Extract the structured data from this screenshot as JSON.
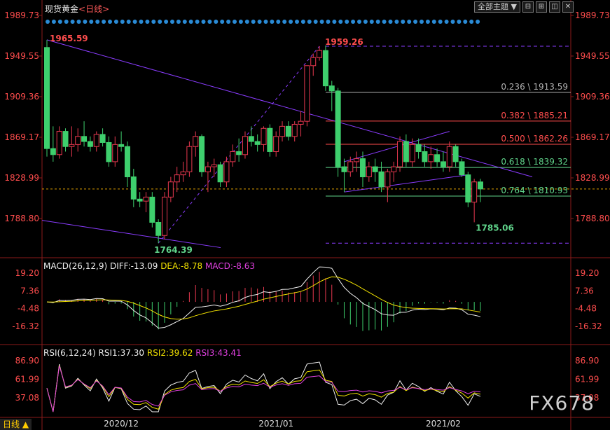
{
  "header": {
    "title": "现货黄金",
    "period": "<日线>",
    "theme_select": "全部主题",
    "icons": [
      "collapse-icon",
      "expand-icon",
      "restore-icon",
      "close-icon"
    ]
  },
  "tab_label": "日线",
  "watermark": "FX678",
  "colors": {
    "up": "#e8384f",
    "down": "#3ecf6d",
    "fib_trend": "#8a3cff",
    "accent_red": "#ff4d4d",
    "accent_green": "#5fd38a"
  },
  "main_axis": {
    "ticks": [
      "1989.73",
      "1949.55",
      "1909.36",
      "1869.17",
      "1828.99",
      "1788.80"
    ],
    "tick_values": [
      1989.73,
      1949.55,
      1909.36,
      1869.17,
      1828.99,
      1788.8
    ]
  },
  "macd": {
    "legend_prefix": "MACD(26,12,9)",
    "diff": "DIFF:-13.09",
    "dea": "DEA:-8.78",
    "macd": "MACD:-8.63",
    "ticks": [
      "19.20",
      "7.36",
      "-4.48",
      "-16.32"
    ]
  },
  "rsi": {
    "legend_prefix": "RSI(6,12,24)",
    "rsi1": "RSI1:37.30",
    "rsi2": "RSI2:39.62",
    "rsi3": "RSI3:43.41",
    "ticks": [
      "86.90",
      "61.99",
      "37.08"
    ]
  },
  "x_axis_labels": [
    "2020/12",
    "2021/01",
    "2021/02"
  ],
  "annotations": {
    "high1": "1965.59",
    "low1": "1764.39",
    "high2": "1959.26",
    "low2": "1785.06"
  },
  "fib_levels": [
    {
      "label": "0.236 \\ 1913.59",
      "value": 1913.59,
      "color": "#b0b0b0"
    },
    {
      "label": "0.382 \\ 1885.21",
      "value": 1885.21,
      "color": "#ff4d4d"
    },
    {
      "label": "0.500 \\ 1862.26",
      "value": 1862.26,
      "color": "#ff4d4d"
    },
    {
      "label": "0.618 \\ 1839.32",
      "value": 1839.32,
      "color": "#5fd38a"
    },
    {
      "label": "0.764 \\ 1810.93",
      "value": 1810.93,
      "color": "#5fd38a"
    }
  ],
  "chart_data": {
    "type": "candlestick",
    "title": "现货黄金 <日线>",
    "ylim": [
      1760,
      1995
    ],
    "x_labels": [
      "2020/12",
      "2021/01",
      "2021/02"
    ],
    "candles": [
      [
        1958,
        1965.59,
        1850,
        1858
      ],
      [
        1858,
        1880,
        1845,
        1852
      ],
      [
        1852,
        1880,
        1848,
        1875
      ],
      [
        1875,
        1878,
        1855,
        1860
      ],
      [
        1860,
        1880,
        1850,
        1862
      ],
      [
        1862,
        1878,
        1855,
        1870
      ],
      [
        1870,
        1885,
        1860,
        1865
      ],
      [
        1865,
        1870,
        1855,
        1860
      ],
      [
        1860,
        1875,
        1855,
        1872
      ],
      [
        1872,
        1878,
        1860,
        1864
      ],
      [
        1864,
        1870,
        1840,
        1845
      ],
      [
        1845,
        1870,
        1840,
        1862
      ],
      [
        1862,
        1875,
        1855,
        1860
      ],
      [
        1860,
        1865,
        1820,
        1830
      ],
      [
        1830,
        1838,
        1800,
        1808
      ],
      [
        1808,
        1815,
        1800,
        1806
      ],
      [
        1806,
        1815,
        1795,
        1810
      ],
      [
        1810,
        1815,
        1780,
        1785
      ],
      [
        1785,
        1788,
        1764.39,
        1772
      ],
      [
        1772,
        1815,
        1768,
        1810
      ],
      [
        1810,
        1830,
        1805,
        1825
      ],
      [
        1825,
        1840,
        1815,
        1832
      ],
      [
        1832,
        1845,
        1825,
        1835
      ],
      [
        1835,
        1865,
        1830,
        1860
      ],
      [
        1860,
        1875,
        1850,
        1870
      ],
      [
        1870,
        1872,
        1830,
        1835
      ],
      [
        1835,
        1845,
        1815,
        1840
      ],
      [
        1840,
        1848,
        1830,
        1842
      ],
      [
        1842,
        1845,
        1820,
        1825
      ],
      [
        1825,
        1850,
        1820,
        1845
      ],
      [
        1845,
        1862,
        1840,
        1855
      ],
      [
        1855,
        1868,
        1845,
        1852
      ],
      [
        1852,
        1875,
        1848,
        1870
      ],
      [
        1870,
        1880,
        1860,
        1865
      ],
      [
        1865,
        1872,
        1855,
        1862
      ],
      [
        1862,
        1880,
        1855,
        1878
      ],
      [
        1878,
        1882,
        1850,
        1855
      ],
      [
        1855,
        1875,
        1850,
        1870
      ],
      [
        1870,
        1885,
        1865,
        1880
      ],
      [
        1880,
        1885,
        1866,
        1870
      ],
      [
        1870,
        1885,
        1865,
        1882
      ],
      [
        1882,
        1895,
        1870,
        1885
      ],
      [
        1885,
        1940,
        1880,
        1940
      ],
      [
        1940,
        1952,
        1930,
        1948
      ],
      [
        1948,
        1959.26,
        1945,
        1955
      ],
      [
        1955,
        1960,
        1915,
        1920
      ],
      [
        1920,
        1925,
        1895,
        1915
      ],
      [
        1915,
        1918,
        1830,
        1840
      ],
      [
        1840,
        1848,
        1815,
        1835
      ],
      [
        1835,
        1850,
        1830,
        1845
      ],
      [
        1845,
        1855,
        1835,
        1848
      ],
      [
        1848,
        1855,
        1820,
        1830
      ],
      [
        1830,
        1845,
        1825,
        1840
      ],
      [
        1840,
        1848,
        1825,
        1835
      ],
      [
        1835,
        1845,
        1815,
        1820
      ],
      [
        1820,
        1838,
        1805,
        1835
      ],
      [
        1835,
        1845,
        1825,
        1840
      ],
      [
        1840,
        1870,
        1835,
        1865
      ],
      [
        1865,
        1872,
        1840,
        1845
      ],
      [
        1845,
        1868,
        1840,
        1862
      ],
      [
        1862,
        1868,
        1848,
        1855
      ],
      [
        1855,
        1862,
        1840,
        1845
      ],
      [
        1845,
        1860,
        1838,
        1852
      ],
      [
        1852,
        1858,
        1840,
        1845
      ],
      [
        1845,
        1855,
        1835,
        1840
      ],
      [
        1840,
        1865,
        1835,
        1860
      ],
      [
        1860,
        1862,
        1840,
        1845
      ],
      [
        1845,
        1848,
        1830,
        1832
      ],
      [
        1832,
        1835,
        1800,
        1805
      ],
      [
        1805,
        1828,
        1785.06,
        1825
      ],
      [
        1825,
        1828,
        1805,
        1818
      ]
    ]
  }
}
